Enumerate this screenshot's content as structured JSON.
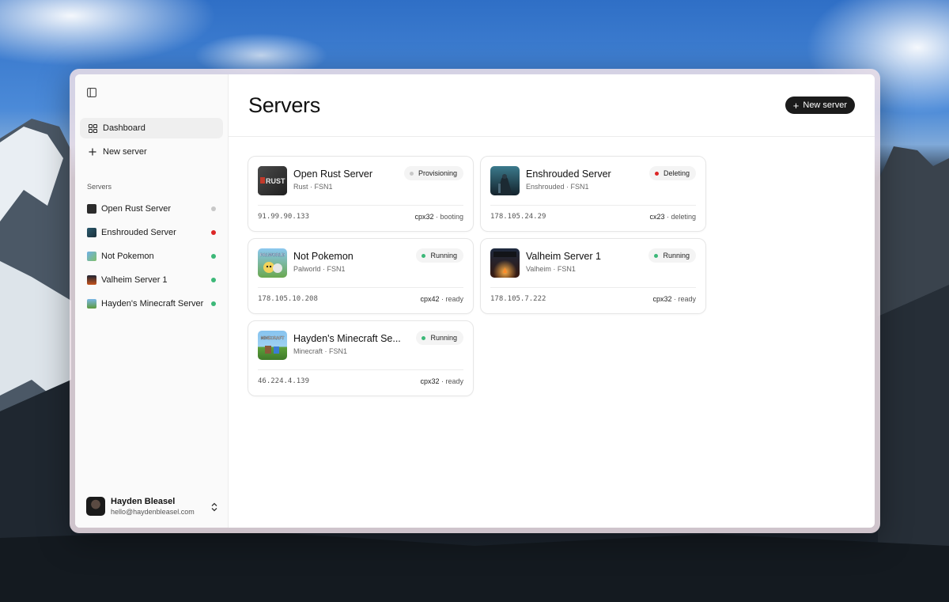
{
  "app": {
    "page_title": "Servers",
    "new_server_button": "New server"
  },
  "sidebar": {
    "nav": [
      {
        "label": "Dashboard",
        "icon": "dashboard-icon",
        "active": true
      },
      {
        "label": "New server",
        "icon": "plus-icon",
        "active": false
      }
    ],
    "section_label": "Servers",
    "servers": [
      {
        "name": "Open Rust Server",
        "status_color": "#c8c8c8"
      },
      {
        "name": "Enshrouded Server",
        "status_color": "#dc2626"
      },
      {
        "name": "Not Pokemon",
        "status_color": "#3cb878"
      },
      {
        "name": "Valheim Server 1",
        "status_color": "#3cb878"
      },
      {
        "name": "Hayden's Minecraft Server",
        "status_color": "#3cb878"
      }
    ],
    "user": {
      "name": "Hayden Bleasel",
      "email": "hello@haydenbleasel.com"
    }
  },
  "cards": [
    {
      "title": "Open Rust Server",
      "game": "Rust",
      "region": "FSN1",
      "sub": "Rust · FSN1",
      "status": "Provisioning",
      "status_color": "#c8c8c8",
      "ip": "91.99.90.133",
      "type": "cpx32",
      "state": " · booting"
    },
    {
      "title": "Enshrouded Server",
      "game": "Enshrouded",
      "region": "FSN1",
      "sub": "Enshrouded · FSN1",
      "status": "Deleting",
      "status_color": "#dc2626",
      "ip": "178.105.24.29",
      "type": "cx23",
      "state": " · deleting"
    },
    {
      "title": "Not Pokemon",
      "game": "Palworld",
      "region": "FSN1",
      "sub": "Palworld · FSN1",
      "status": "Running",
      "status_color": "#3cb878",
      "ip": "178.105.10.208",
      "type": "cpx42",
      "state": " · ready"
    },
    {
      "title": "Valheim Server 1",
      "game": "Valheim",
      "region": "FSN1",
      "sub": "Valheim · FSN1",
      "status": "Running",
      "status_color": "#3cb878",
      "ip": "178.105.7.222",
      "type": "cpx32",
      "state": " · ready"
    },
    {
      "title": "Hayden's Minecraft Se...",
      "game": "Minecraft",
      "region": "FSN1",
      "sub": "Minecraft · FSN1",
      "status": "Running",
      "status_color": "#3cb878",
      "ip": "46.224.4.139",
      "type": "cpx32",
      "state": " · ready"
    }
  ],
  "art_labels": {
    "rust": "RUST",
    "palworld": "PALWORLD",
    "minecraft": "MINECRAFT"
  },
  "colors": {
    "running": "#3cb878",
    "deleting": "#dc2626",
    "provisioning": "#c8c8c8",
    "primary_button": "#1b1b1b"
  }
}
